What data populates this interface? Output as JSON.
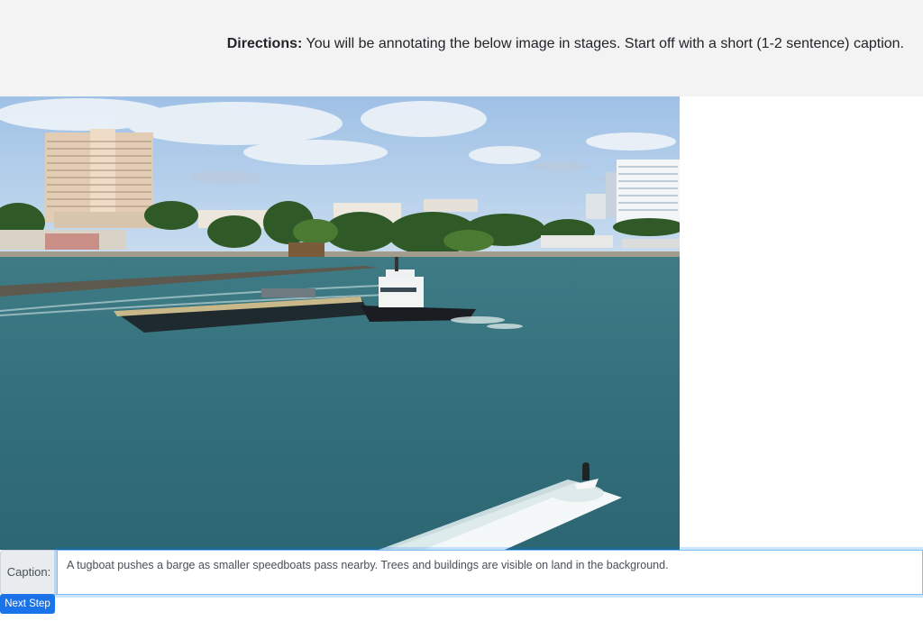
{
  "directions": {
    "label": "Directions:",
    "text": " You will be annotating the below image in stages. Start off with a short (1-2 sentence) caption."
  },
  "caption": {
    "label": "Caption:",
    "value": "A tugboat pushes a barge as smaller speedboats pass nearby. Trees and buildings are visible on land in the background."
  },
  "actions": {
    "next_label": "Next Step"
  }
}
